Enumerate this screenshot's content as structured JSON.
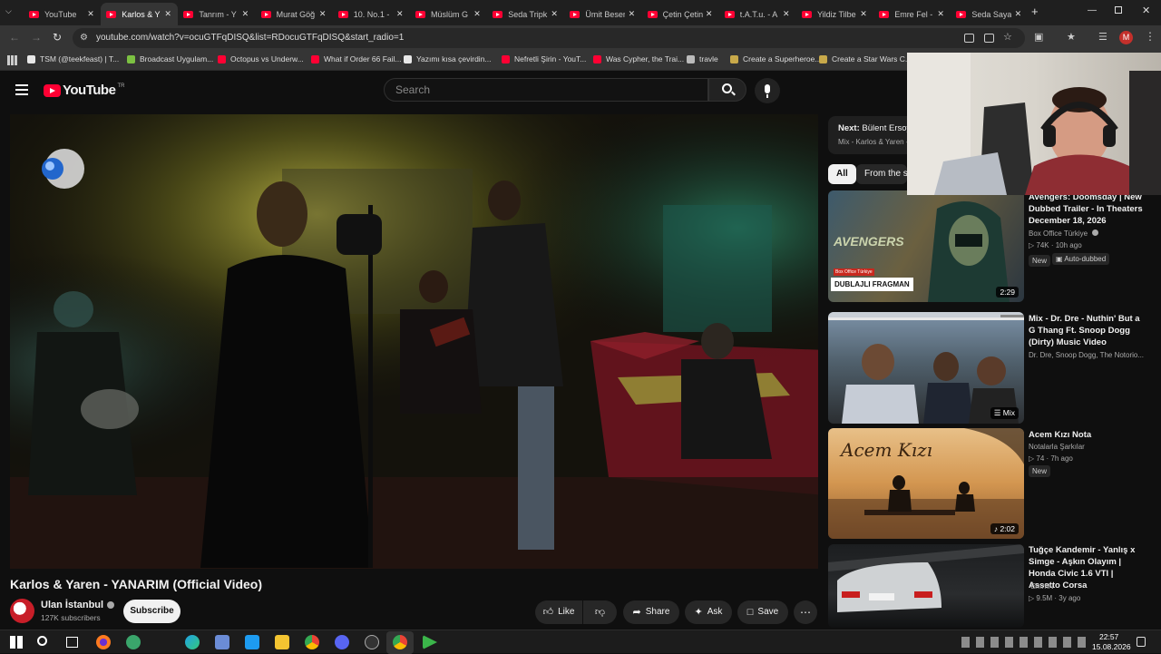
{
  "browser": {
    "tabs": [
      {
        "title": "YouTube",
        "active": false
      },
      {
        "title": "Karlos & Y",
        "active": true
      },
      {
        "title": "Tanrım - Y",
        "active": false
      },
      {
        "title": "Murat Göğ",
        "active": false
      },
      {
        "title": "10. No.1 -",
        "active": false
      },
      {
        "title": "Müslüm G",
        "active": false
      },
      {
        "title": "Seda Tripk",
        "active": false
      },
      {
        "title": "Ümit Besen",
        "active": false
      },
      {
        "title": "Çetin Çetin",
        "active": false
      },
      {
        "title": "t.A.T.u. - A",
        "active": false
      },
      {
        "title": "Yildiz Tilbe",
        "active": false
      },
      {
        "title": "Emre Fel -",
        "active": false
      },
      {
        "title": "Seda Sayai",
        "active": false
      }
    ],
    "url": "youtube.com/watch?v=ocuGTFqDISQ&list=RDocuGTFqDISQ&start_radio=1",
    "profile_initial": "M",
    "bookmarks": [
      {
        "label": "TSM (@teekfeast) | T...",
        "color": "#e8e8e8"
      },
      {
        "label": "Broadcast Uygulam...",
        "color": "#7cc142"
      },
      {
        "label": "Octopus vs Underw...",
        "color": "#ff0033"
      },
      {
        "label": "What if Order 66 Fail...",
        "color": "#ff0033"
      },
      {
        "label": "Yazımı kısa çevirdin...",
        "color": "#e8e8e8"
      },
      {
        "label": "Nefretli Şirin - YouT...",
        "color": "#ff0033"
      },
      {
        "label": "Was Cypher, the Trai...",
        "color": "#ff0033"
      },
      {
        "label": "travle",
        "color": "#bbbbbb"
      },
      {
        "label": "Create a Superheroe...",
        "color": "#c8a94a"
      },
      {
        "label": "Create a Star Wars C...",
        "color": "#c8a94a"
      }
    ]
  },
  "youtube": {
    "logo_text": "YouTube",
    "logo_region": "TR",
    "search_placeholder": "Search"
  },
  "video": {
    "title": "Karlos & Yaren - YANARIM (Official Video)",
    "channel": "Ulan İstanbul",
    "subscribers": "127K subscribers",
    "subscribe_label": "Subscribe",
    "like_label": "Like",
    "share_label": "Share",
    "ask_label": "Ask",
    "save_label": "Save"
  },
  "sidebar": {
    "next_label": "Next:",
    "next_title": "Bülent Ersoy",
    "next_sub": "Mix - Karlos & Yaren -",
    "chips": [
      "All",
      "From the se"
    ],
    "videos": [
      {
        "title": "Avengers: Doomsday | New Dubbed Trailer - In Theaters December 18, 2026",
        "channel": "Box Office Türkiye",
        "meta": "74K · 10h ago",
        "badges": [
          "New",
          "Auto-dubbed"
        ],
        "duration": "2:29",
        "thumb_caption": "DUBLAJLI FRAGMAN",
        "thumb_brand": "AVENGERS",
        "thumb_small": "Box Office Türkiye"
      },
      {
        "title": "Mix - Dr. Dre - Nuthin' But a G Thang Ft. Snoop Dogg (Dirty) Music Video",
        "channel": "Dr. Dre, Snoop Dogg, The Notorio...",
        "meta": "",
        "badges": [],
        "duration": "Mix"
      },
      {
        "title": "Acem Kızı Nota",
        "channel": "Notalarla Şarkılar",
        "meta": "74 · 7h ago",
        "badges": [
          "New"
        ],
        "duration": "2:02",
        "thumb_caption": "Acem Kızı"
      },
      {
        "title": "Tuğçe Kandemir - Yanlış x Simge - Aşkın Olayım | Honda Civic 1.6 VTI | Assetto Corsa",
        "channel": "-EmrhN",
        "meta": "9.5M · 3y ago",
        "badges": [],
        "duration": ""
      }
    ]
  },
  "taskbar": {
    "time": "22:57",
    "date": "15.08.2026"
  },
  "colors": {
    "yt_red": "#ff0033",
    "bg": "#0f0f0f"
  }
}
